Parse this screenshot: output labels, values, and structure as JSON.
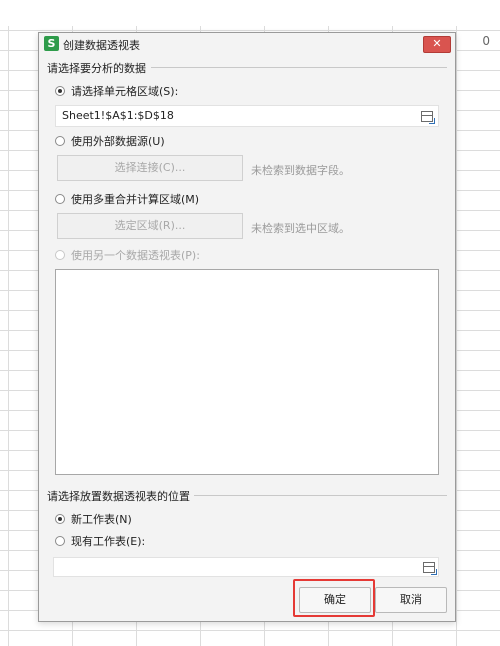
{
  "sheet": {
    "column_label": "0"
  },
  "dialog": {
    "title": "创建数据透视表",
    "app_icon": "S",
    "close_glyph": "✕",
    "section1": {
      "label": "请选择要分析的数据",
      "option_range": "请选择单元格区域(S):",
      "range_value": "Sheet1!$A$1:$D$18",
      "option_external": "使用外部数据源(U)",
      "choose_connection": "选择连接(C)...",
      "no_field_hint": "未检索到数据字段。",
      "option_consolidate": "使用多重合并计算区域(M)",
      "select_region": "选定区域(R)...",
      "no_region_hint": "未检索到选中区域。",
      "option_other_pivot": "使用另一个数据透视表(P):"
    },
    "section2": {
      "label": "请选择放置数据透视表的位置",
      "option_new_sheet": "新工作表(N)",
      "option_existing_sheet": "现有工作表(E):",
      "existing_value": ""
    },
    "buttons": {
      "ok": "确定",
      "cancel": "取消"
    }
  }
}
